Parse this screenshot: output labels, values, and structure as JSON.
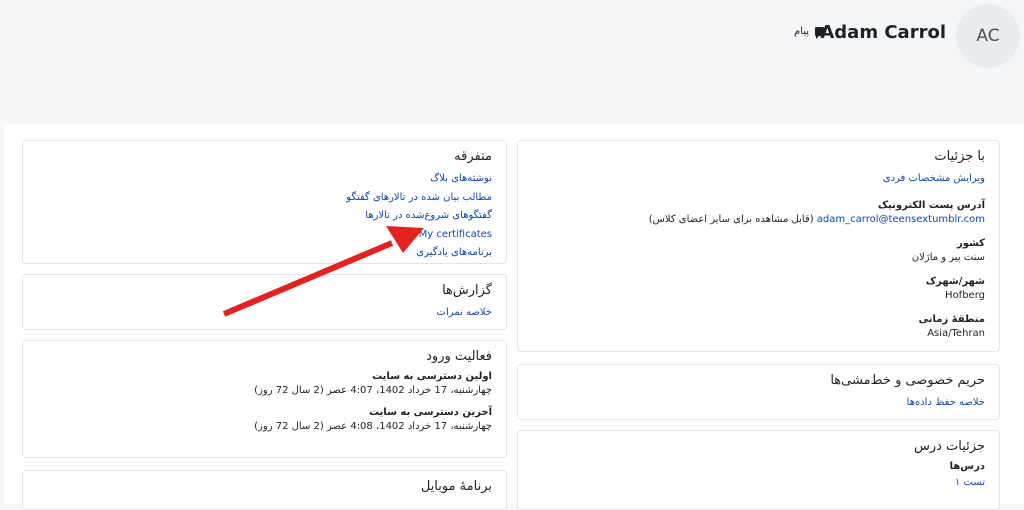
{
  "header": {
    "avatar_initials": "AC",
    "user_name": "Adam Carrol",
    "message_label": "پیام"
  },
  "details": {
    "title": "با جزئیات",
    "edit_profile": "ویرایش مشخصات فردی",
    "email_label": "آدرس پست الکترونیک",
    "email_value": "adam_carrol@teensextumblr.com",
    "email_note": "(قابل مشاهده برای سایر اعضای کلاس)",
    "country_label": "کشور",
    "country_value": "سنت پیر و ماژلان",
    "city_label": "شهر/شهرک",
    "city_value": "Hofberg",
    "timezone_label": "منطقهٔ زمانی",
    "timezone_value": "Asia/Tehran"
  },
  "privacy": {
    "title": "حریم خصوصی و خط‌مشی‌ها",
    "data_summary": "خلاصه حفظ داده‌ها"
  },
  "course_details": {
    "title": "جزئیات درس",
    "courses_label": "درس‌ها",
    "course_link": "تست ۱"
  },
  "misc": {
    "title": "متفرقه",
    "links": [
      "نوشته‌های بلاگ",
      "مطالب بیان شده در تالارهای گفتگو",
      "گفتگوهای شروع‌شده در تالارها",
      "My certificates",
      "برنامه‌های یادگیری"
    ]
  },
  "reports": {
    "title": "گزارش‌ها",
    "grades_overview": "خلاصه نمرات"
  },
  "login_activity": {
    "title": "فعالیت ورود",
    "first_access_label": "اولین دسترسی به سایت",
    "first_access_value": "چهارشنبه، 17 خرداد 1402، 4:07 عصر  (2 سال 72 روز)",
    "last_access_label": "آخرین دسترسی به سایت",
    "last_access_value": "چهارشنبه، 17 خرداد 1402، 4:08 عصر  (2 سال 72 روز)"
  },
  "mobile_app": {
    "title": "برنامهٔ موبایل"
  },
  "colors": {
    "link": "#0f47ad",
    "arrow": "#e32222"
  }
}
